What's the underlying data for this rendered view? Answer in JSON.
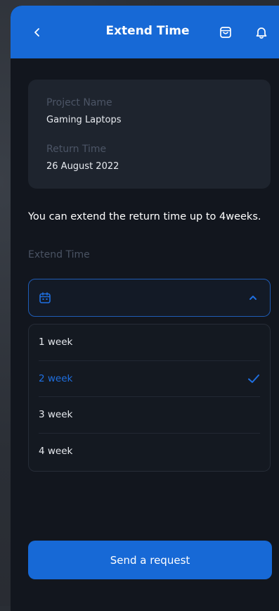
{
  "header": {
    "title": "Extend Time",
    "back_icon": "chevron-left-icon",
    "bag_icon": "shopping-bag-icon",
    "bell_icon": "bell-icon"
  },
  "info": {
    "project_label": "Project Name",
    "project_value": "Gaming Laptops",
    "return_label": "Return Time",
    "return_value": "26 August 2022"
  },
  "notice": "You can extend the return time up to 4weeks.",
  "extend": {
    "label": "Extend Time",
    "select_icon": "calendar-icon",
    "toggle_icon": "chevron-up-icon",
    "options": [
      {
        "label": "1 week",
        "selected": false
      },
      {
        "label": "2 week",
        "selected": true
      },
      {
        "label": "3 week",
        "selected": false
      },
      {
        "label": "4 week",
        "selected": false
      }
    ]
  },
  "actions": {
    "send_label": "Send a request"
  },
  "colors": {
    "accent": "#1769d6",
    "background": "#12161e",
    "card": "#1e242e"
  }
}
